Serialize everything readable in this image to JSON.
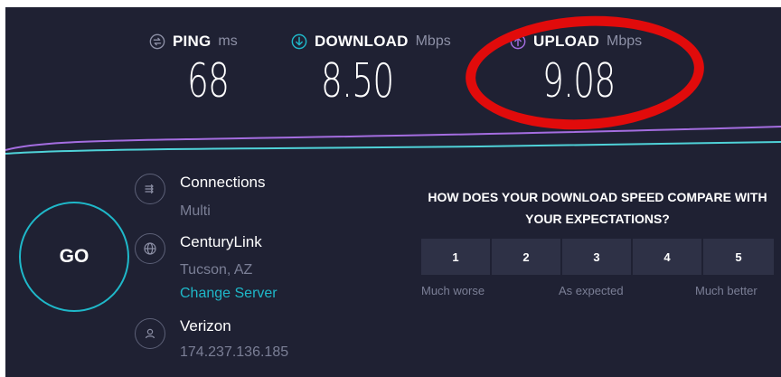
{
  "metrics": {
    "ping": {
      "label": "PING",
      "unit": "ms",
      "value": "68"
    },
    "download": {
      "label": "DOWNLOAD",
      "unit": "Mbps",
      "value": "8.50"
    },
    "upload": {
      "label": "UPLOAD",
      "unit": "Mbps",
      "value": "9.08"
    }
  },
  "go_label": "GO",
  "connections": {
    "title": "Connections",
    "value": "Multi"
  },
  "server": {
    "name": "CenturyLink",
    "location": "Tucson, AZ",
    "change_label": "Change Server"
  },
  "isp": {
    "name": "Verizon",
    "ip": "174.237.136.185"
  },
  "survey": {
    "question": "HOW DOES YOUR DOWNLOAD SPEED COMPARE WITH YOUR EXPECTATIONS?",
    "options": [
      "1",
      "2",
      "3",
      "4",
      "5"
    ],
    "scale": {
      "low": "Much worse",
      "mid": "As expected",
      "high": "Much better"
    }
  },
  "colors": {
    "background": "#1f2133",
    "accent": "#1fb8c9",
    "upload": "#a46de0",
    "annotation": "#e10b0b"
  }
}
